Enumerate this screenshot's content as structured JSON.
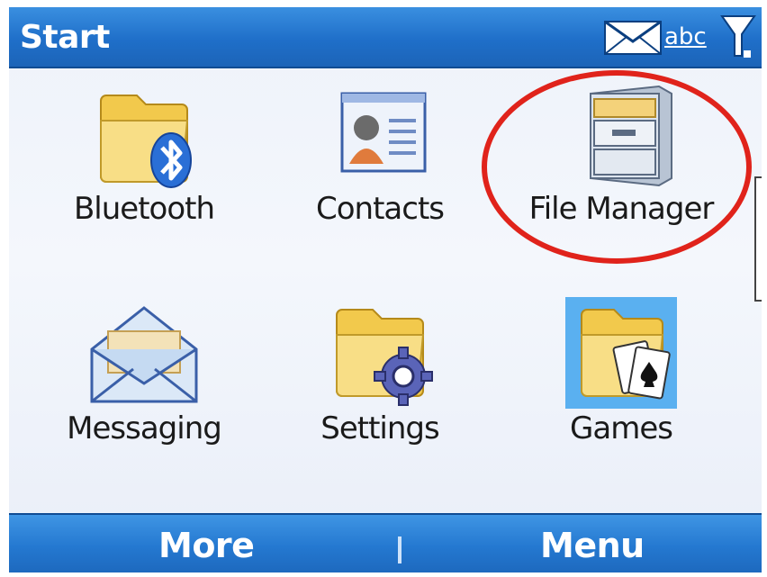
{
  "titlebar": {
    "title": "Start",
    "indicator_text": "abc",
    "icons": [
      "envelope-icon",
      "signal-strength-icon"
    ]
  },
  "items": [
    {
      "label": "Bluetooth",
      "icon": "bluetooth-folder-icon"
    },
    {
      "label": "Contacts",
      "icon": "contact-card-icon"
    },
    {
      "label": "File Manager",
      "icon": "file-cabinet-icon",
      "highlighted": true
    },
    {
      "label": "Messaging",
      "icon": "envelope-open-icon"
    },
    {
      "label": "Settings",
      "icon": "settings-folder-gear-icon"
    },
    {
      "label": "Games",
      "icon": "games-folder-cards-icon",
      "selected": true
    }
  ],
  "softkeys": {
    "left": "More",
    "right": "Menu"
  },
  "colors": {
    "titlebar": "#1f6fc9",
    "selection": "#5ab0f0",
    "highlight_ring": "#e0231b"
  }
}
